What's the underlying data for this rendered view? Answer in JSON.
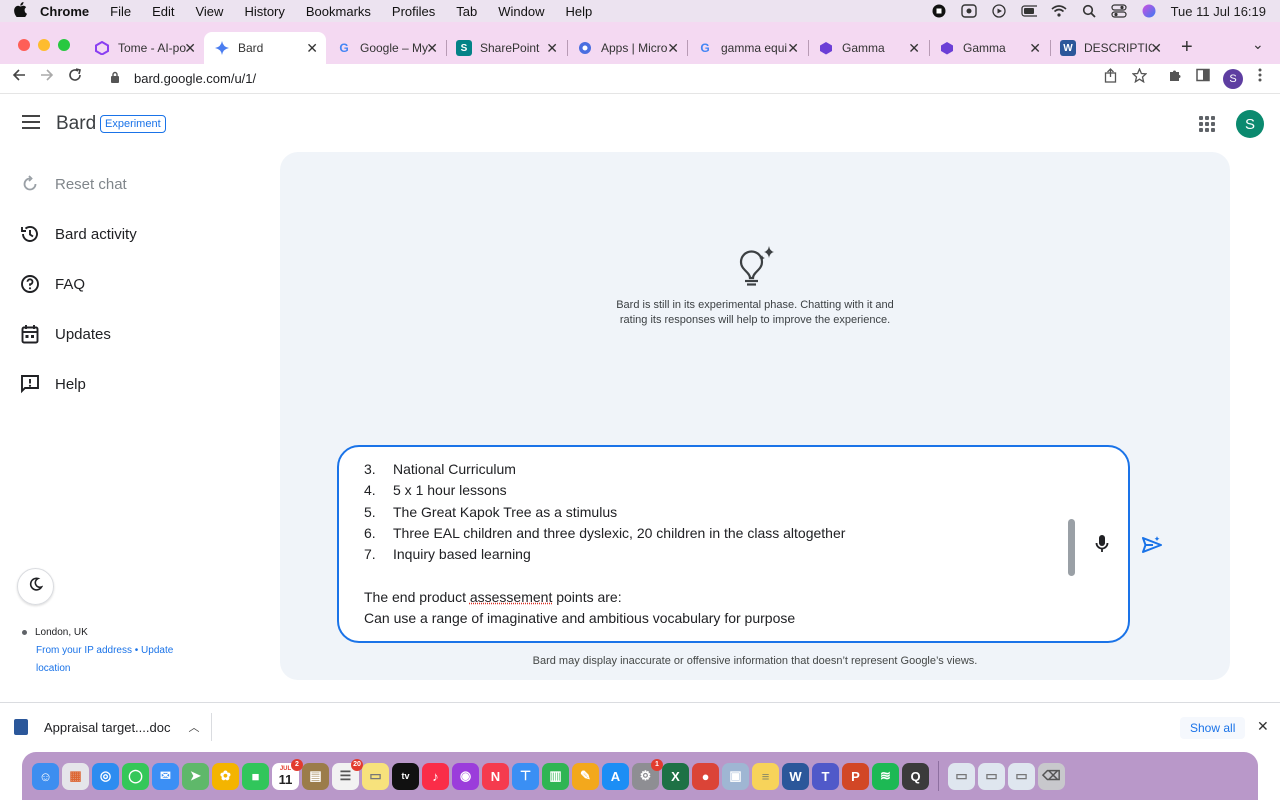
{
  "menubar": {
    "app": "Chrome",
    "items": [
      "File",
      "Edit",
      "View",
      "History",
      "Bookmarks",
      "Profiles",
      "Tab",
      "Window",
      "Help"
    ],
    "clock": "Tue 11 Jul  16:19"
  },
  "tabs": [
    {
      "title": "Tome - AI-po",
      "icon": "tome-icon",
      "color": "#7a3ff2"
    },
    {
      "title": "Bard",
      "icon": "bard-sparkle-icon",
      "color": "#4285f4"
    },
    {
      "title": "Google – My",
      "icon": "google-icon",
      "color": "#4285f4"
    },
    {
      "title": "SharePoint",
      "icon": "sharepoint-icon",
      "color": "#038387"
    },
    {
      "title": "Apps | Micro",
      "icon": "apps-icon",
      "color": "#4a6ee0"
    },
    {
      "title": "gamma equi",
      "icon": "google-icon",
      "color": "#4285f4"
    },
    {
      "title": "Gamma",
      "icon": "gamma-icon",
      "color": "#6b3fd6"
    },
    {
      "title": "Gamma",
      "icon": "gamma-icon",
      "color": "#6b3fd6"
    },
    {
      "title": "DESCRIPTIO",
      "icon": "word-icon",
      "color": "#2b579a"
    }
  ],
  "address": {
    "url": "bard.google.com/u/1/",
    "profile_initial": "S"
  },
  "bard": {
    "brand": "Bard",
    "badge": "Experiment",
    "avatar_initial": "S",
    "avatar_color": "#0b8a6f",
    "accent": "#1a73e8"
  },
  "sidebar": {
    "items": [
      {
        "label": "Reset chat",
        "icon": "reset-icon"
      },
      {
        "label": "Bard activity",
        "icon": "history-icon"
      },
      {
        "label": "FAQ",
        "icon": "help-circle-icon"
      },
      {
        "label": "Updates",
        "icon": "calendar-icon"
      },
      {
        "label": "Help",
        "icon": "feedback-icon"
      }
    ],
    "location_city": "London, UK",
    "location_source": "From your IP address",
    "location_update": "Update",
    "location_update2": "location"
  },
  "main": {
    "intro_line1": "Bard is still in its experimental phase. Chatting with it and",
    "intro_line2": "rating its responses will help to improve the experience.",
    "prompt_items": [
      {
        "num": "3.",
        "text": "National Curriculum"
      },
      {
        "num": "4.",
        "text": "5 x 1 hour lessons"
      },
      {
        "num": "5.",
        "text": "The Great Kapok Tree as a stimulus"
      },
      {
        "num": "6.",
        "text": "Three EAL children and three dyslexic, 20 children in the class altogether"
      },
      {
        "num": "7.",
        "text": "Inquiry based learning"
      }
    ],
    "prompt_assess_pre": "The end product ",
    "prompt_assess_word": "assessement",
    "prompt_assess_post": " points are:",
    "prompt_last": "Can use a range of imaginative and ambitious vocabulary for purpose",
    "disclaimer": "Bard may display inaccurate or offensive information that doesn’t represent Google’s views."
  },
  "downloads": {
    "file": "Appraisal target....doc",
    "show_all": "Show all"
  },
  "dock": {
    "calendar_month": "JUL",
    "calendar_day": "11",
    "calendar_badge": "2",
    "reminders_badge": "20",
    "settings_badge": "1",
    "apps": [
      {
        "name": "finder-icon",
        "color": "#3d8ef0",
        "glyph": "☺"
      },
      {
        "name": "launchpad-icon",
        "color": "#e5e5ea",
        "glyph": "▦"
      },
      {
        "name": "safari-icon",
        "color": "#2d8cf0",
        "glyph": "◎"
      },
      {
        "name": "messages-icon",
        "color": "#34c759",
        "glyph": "◯"
      },
      {
        "name": "mail-icon",
        "color": "#3b8ff5",
        "glyph": "✉"
      },
      {
        "name": "maps-icon",
        "color": "#5fb86a",
        "glyph": "➤"
      },
      {
        "name": "photos-icon",
        "color": "#f4b400",
        "glyph": "✿"
      },
      {
        "name": "facetime-icon",
        "color": "#31c65b",
        "glyph": "■"
      }
    ],
    "apps2": [
      {
        "name": "notes-app-icon",
        "color": "#9b7c4a",
        "glyph": "▤"
      },
      {
        "name": "reminders-icon",
        "color": "#f2f2f2",
        "glyph": "☰"
      },
      {
        "name": "stickies-icon",
        "color": "#f7e27c",
        "glyph": "▭"
      },
      {
        "name": "apple-tv-icon",
        "color": "#111111",
        "glyph": "tv"
      },
      {
        "name": "music-icon",
        "color": "#fa2d48",
        "glyph": "♪"
      },
      {
        "name": "podcasts-icon",
        "color": "#9b3ddb",
        "glyph": "◉"
      },
      {
        "name": "news-icon",
        "color": "#f53b4e",
        "glyph": "N"
      },
      {
        "name": "keynote-icon",
        "color": "#3a8ff4",
        "glyph": "⊤"
      },
      {
        "name": "numbers-icon",
        "color": "#2fb553",
        "glyph": "▥"
      },
      {
        "name": "pages-icon",
        "color": "#f3a81c",
        "glyph": "✎"
      },
      {
        "name": "app-store-icon",
        "color": "#1c8ef5",
        "glyph": "A"
      },
      {
        "name": "system-settings-icon",
        "color": "#8e8e93",
        "glyph": "⚙"
      },
      {
        "name": "excel-icon",
        "color": "#1e7145",
        "glyph": "X"
      },
      {
        "name": "chrome-icon",
        "color": "#db4437",
        "glyph": "●"
      },
      {
        "name": "preview-icon",
        "color": "#9fb6d3",
        "glyph": "▣"
      },
      {
        "name": "notes-icon",
        "color": "#f7d35a",
        "glyph": "≡"
      },
      {
        "name": "word-icon",
        "color": "#2b579a",
        "glyph": "W"
      },
      {
        "name": "teams-icon",
        "color": "#5059c9",
        "glyph": "T"
      },
      {
        "name": "powerpoint-icon",
        "color": "#d24726",
        "glyph": "P"
      },
      {
        "name": "spotify-icon",
        "color": "#1db954",
        "glyph": "≋"
      },
      {
        "name": "quicktime-icon",
        "color": "#3b3b3b",
        "glyph": "Q"
      }
    ],
    "apps3": [
      {
        "name": "downloads-stack-icon",
        "color": "#dfe6ef",
        "glyph": "▭"
      },
      {
        "name": "documents-stack-icon",
        "color": "#dfe6ef",
        "glyph": "▭"
      },
      {
        "name": "desktop-stack-icon",
        "color": "#dfe6ef",
        "glyph": "▭"
      },
      {
        "name": "trash-icon",
        "color": "#c8c8cc",
        "glyph": "🗑"
      }
    ]
  }
}
